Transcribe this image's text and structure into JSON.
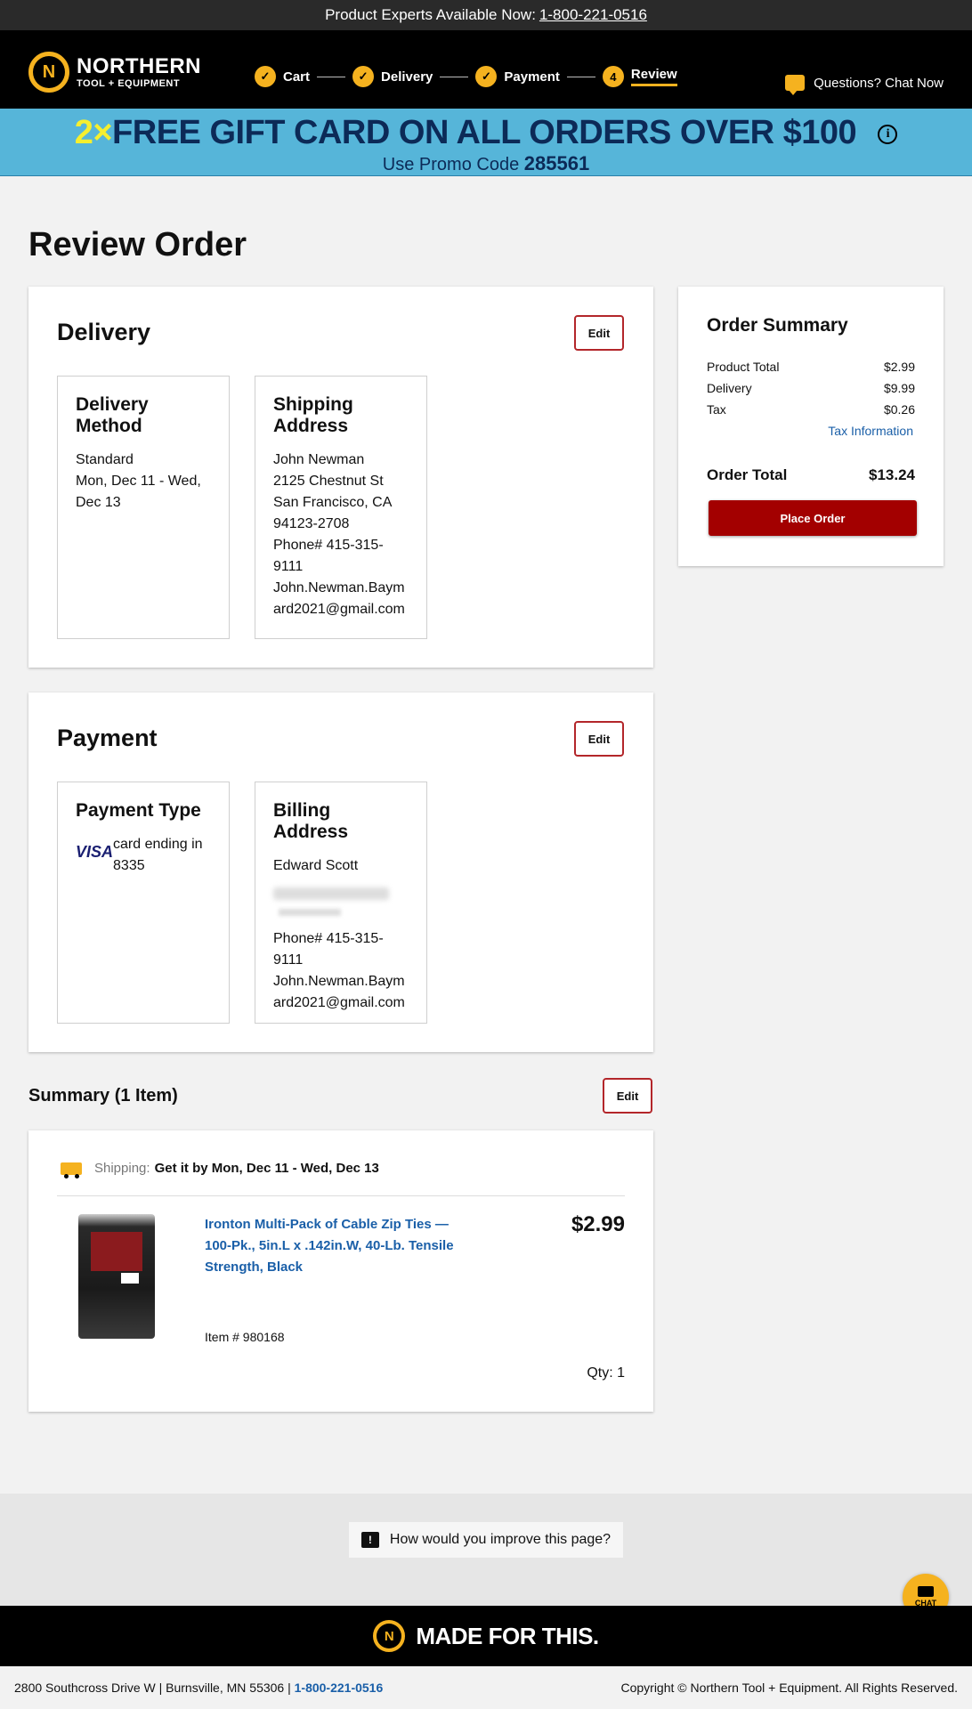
{
  "topbar": {
    "text": "Product Experts Available Now:",
    "phone": "1-800-221-0516"
  },
  "header": {
    "logo_line1": "NORTHERN",
    "logo_line2": "TOOL + EQUIPMENT",
    "steps": [
      {
        "label": "Cart",
        "state": "done"
      },
      {
        "label": "Delivery",
        "state": "done"
      },
      {
        "label": "Payment",
        "state": "done"
      },
      {
        "label": "Review",
        "state": "active",
        "number": "4"
      }
    ],
    "chat_label": "Questions? Chat Now"
  },
  "promo": {
    "multiplier": "2×",
    "headline_bold": "FREE GIFT CARD",
    "headline_rest": "ON ALL ORDERS OVER $100",
    "code_label": "Use Promo Code",
    "code": "285561"
  },
  "page_title": "Review Order",
  "delivery": {
    "title": "Delivery",
    "edit_label": "Edit",
    "method": {
      "heading": "Delivery Method",
      "lines": [
        "Standard",
        "Mon, Dec 11 - Wed, Dec 13"
      ]
    },
    "address": {
      "heading": "Shipping Address",
      "name": "John Newman",
      "street": "2125 Chestnut St",
      "city": "San Francisco, CA 94123-2708",
      "phone": "Phone# 415-315-9111",
      "email": "John.Newman.Baymard2021@gmail.com"
    }
  },
  "payment": {
    "title": "Payment",
    "edit_label": "Edit",
    "type": {
      "heading": "Payment Type",
      "brand": "VISA",
      "text": "card ending in 8335"
    },
    "billing": {
      "heading": "Billing Address",
      "name": "Edward Scott",
      "phone": "Phone# 415-315-9111",
      "email": "John.Newman.Baymard2021@gmail.com"
    }
  },
  "summary": {
    "title": "Summary (1 Item)",
    "edit_label": "Edit",
    "shipping_label": "Shipping:",
    "shipping_text": "Get it by Mon, Dec 11 - Wed, Dec 13",
    "item": {
      "name": "Ironton Multi-Pack of Cable Zip Ties — 100-Pk., 5in.L x .142in.W, 40-Lb. Tensile Strength, Black",
      "price": "$2.99",
      "item_number": "Item # 980168",
      "qty": "Qty: 1"
    }
  },
  "order_summary": {
    "title": "Order Summary",
    "rows": [
      {
        "label": "Product Total",
        "value": "$2.99"
      },
      {
        "label": "Delivery",
        "value": "$9.99"
      },
      {
        "label": "Tax",
        "value": "$0.26"
      }
    ],
    "tax_info": "Tax Information",
    "total_label": "Order Total",
    "total_value": "$13.24",
    "place_order": "Place Order"
  },
  "feedback": {
    "label": "How would you improve this page?"
  },
  "chat_bubble": {
    "label": "CHAT"
  },
  "footer": {
    "tagline": "MADE FOR THIS.",
    "address": "2800 Southcross Drive W | Burnsville, MN 55306 |",
    "phone": "1-800-221-0516",
    "copyright": "Copyright © Northern Tool + Equipment. All Rights Reserved."
  },
  "colors": {
    "brand_yellow": "#f5b21f",
    "promo_blue": "#56b5d9",
    "place_order_red": "#a30000",
    "link_blue": "#1a5fa8"
  }
}
